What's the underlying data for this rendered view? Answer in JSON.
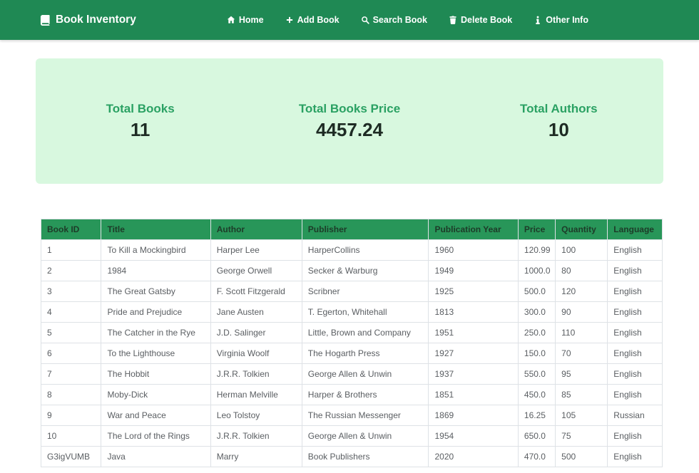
{
  "theme": {
    "navbar_bg": "#1f8954",
    "navbar_text": "#ffffff",
    "stats_bg": "#d8f8df",
    "stats_label_color": "#2aa163",
    "stats_value_color": "#1e2b24",
    "table_header_bg": "#289659",
    "table_header_text": "#1d3b28",
    "table_border": "#dee2e6",
    "cell_text": "#5a5e62"
  },
  "navbar": {
    "brand": "Book Inventory",
    "brand_icon": "book-icon",
    "items": [
      {
        "label": "Home",
        "icon": "home-icon"
      },
      {
        "label": "Add Book",
        "icon": "plus-icon"
      },
      {
        "label": "Search Book",
        "icon": "search-icon"
      },
      {
        "label": "Delete Book",
        "icon": "trash-icon"
      },
      {
        "label": "Other Info",
        "icon": "info-icon"
      }
    ]
  },
  "stats": [
    {
      "label": "Total Books",
      "value": "11"
    },
    {
      "label": "Total Books Price",
      "value": "4457.24"
    },
    {
      "label": "Total Authors",
      "value": "10"
    }
  ],
  "table": {
    "columns": [
      "Book ID",
      "Title",
      "Author",
      "Publisher",
      "Publication Year",
      "Price",
      "Quantity",
      "Language"
    ],
    "rows": [
      [
        "1",
        "To Kill a Mockingbird",
        "Harper Lee",
        "HarperCollins",
        "1960",
        "120.99",
        "100",
        "English"
      ],
      [
        "2",
        "1984",
        "George Orwell",
        "Secker & Warburg",
        "1949",
        "1000.0",
        "80",
        "English"
      ],
      [
        "3",
        "The Great Gatsby",
        "F. Scott Fitzgerald",
        "Scribner",
        "1925",
        "500.0",
        "120",
        "English"
      ],
      [
        "4",
        "Pride and Prejudice",
        "Jane Austen",
        "T. Egerton, Whitehall",
        "1813",
        "300.0",
        "90",
        "English"
      ],
      [
        "5",
        "The Catcher in the Rye",
        "J.D. Salinger",
        "Little, Brown and Company",
        "1951",
        "250.0",
        "110",
        "English"
      ],
      [
        "6",
        "To the Lighthouse",
        "Virginia Woolf",
        "The Hogarth Press",
        "1927",
        "150.0",
        "70",
        "English"
      ],
      [
        "7",
        "The Hobbit",
        "J.R.R. Tolkien",
        "George Allen & Unwin",
        "1937",
        "550.0",
        "95",
        "English"
      ],
      [
        "8",
        "Moby-Dick",
        "Herman Melville",
        "Harper & Brothers",
        "1851",
        "450.0",
        "85",
        "English"
      ],
      [
        "9",
        "War and Peace",
        "Leo Tolstoy",
        "The Russian Messenger",
        "1869",
        "16.25",
        "105",
        "Russian"
      ],
      [
        "10",
        "The Lord of the Rings",
        "J.R.R. Tolkien",
        "George Allen & Unwin",
        "1954",
        "650.0",
        "75",
        "English"
      ],
      [
        "G3igVUMB",
        "Java",
        "Marry",
        "Book Publishers",
        "2020",
        "470.0",
        "500",
        "English"
      ]
    ]
  }
}
